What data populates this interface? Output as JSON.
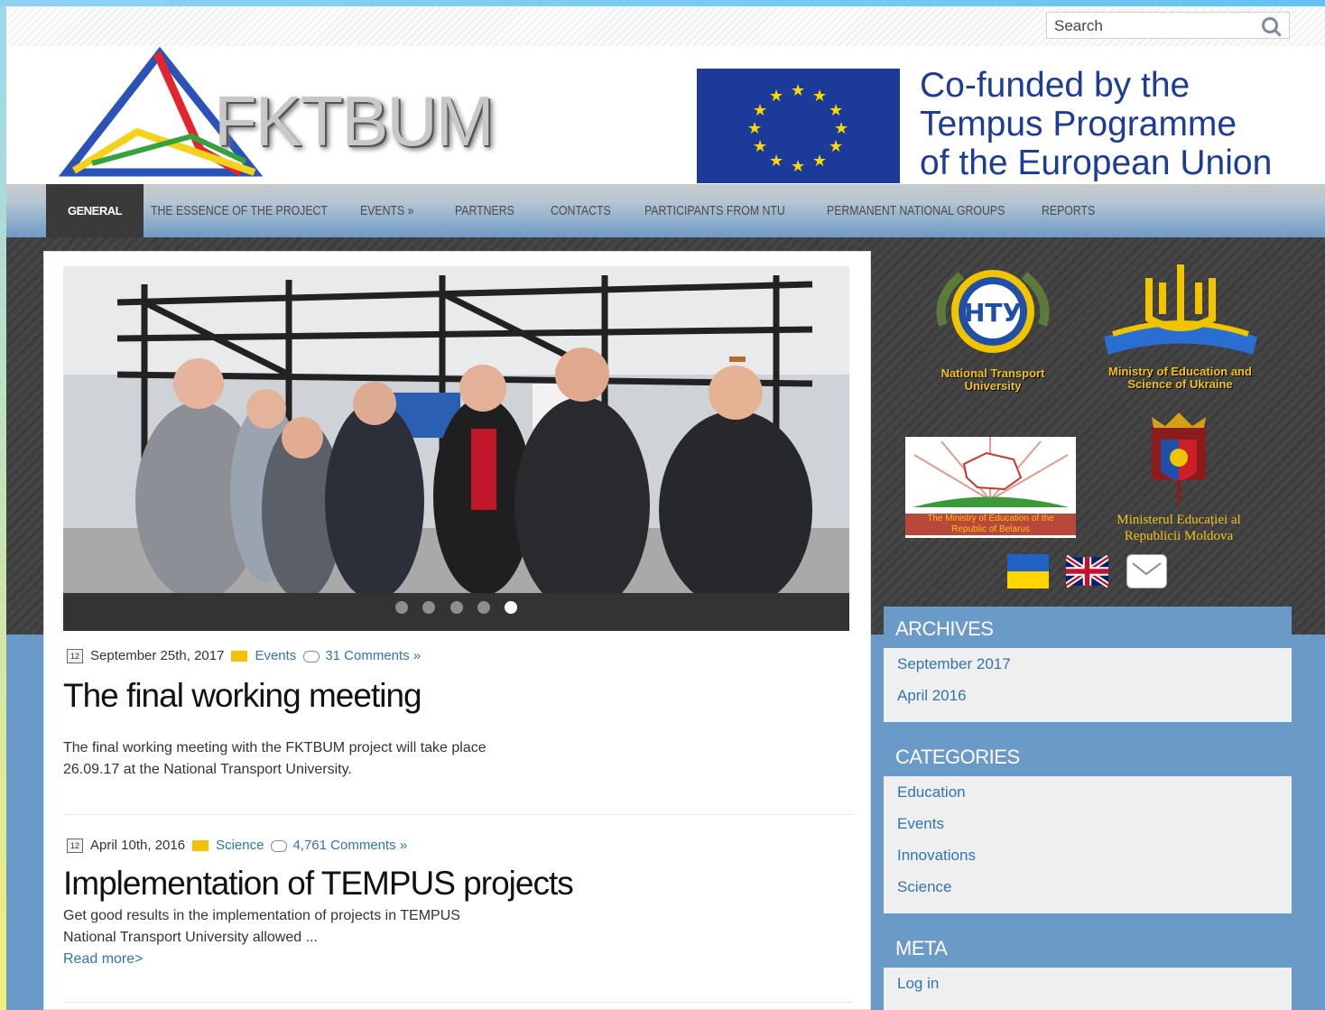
{
  "search": {
    "placeholder": "Search"
  },
  "header": {
    "logo_text": "FKTBUM",
    "eu_lines": [
      "Co-funded by the",
      "Tempus Programme",
      "of the European Union"
    ]
  },
  "nav": {
    "items": [
      "GENERAL",
      "THE ESSENCE OF THE PROJECT",
      "EVENTS »",
      "PARTNERS",
      "CONTACTS",
      "PARTICIPANTS FROM NTU",
      "PERMANENT NATIONAL GROUPS",
      "REPORTS"
    ],
    "active": "GENERAL"
  },
  "slider": {
    "dots": 5,
    "active_dot": 5
  },
  "posts": [
    {
      "date": "September 25th, 2017",
      "category": "Events",
      "comments": "31 Comments »",
      "title": "The final working meeting",
      "body_1": "The final working meeting with the FKTBUM project will take place",
      "body_2": "26.09.17 at the National Transport University."
    },
    {
      "date": "April 10th, 2016",
      "category": "Science",
      "comments": "4,761 Comments »",
      "title": "Implementation of TEMPUS projects",
      "body_1": "Get good results in the implementation of projects in TEMPUS",
      "body_2": "National Transport University allowed ...",
      "read_more": "Read more>"
    }
  ],
  "partners": {
    "ntu_1": "National Transport",
    "ntu_2": "University",
    "ntu_emblem": "НТУ",
    "mon_1": "Ministry of Education and",
    "mon_2": "Science of Ukraine",
    "belarus_1": "The Ministry of Education of the",
    "belarus_2": "Republic of Belarus",
    "moldova_1": "Ministerul Educației al",
    "moldova_2": "Republicii Moldova"
  },
  "sidebar": {
    "archives_title": "ARCHIVES",
    "archives": [
      "September 2017",
      "April 2016"
    ],
    "categories_title": "CATEGORIES",
    "categories": [
      "Education",
      "Events",
      "Innovations",
      "Science"
    ],
    "meta_title": "META",
    "meta": [
      "Log in"
    ]
  },
  "colors": {
    "accent_blue": "#6a9bc8",
    "link": "#2f74b5",
    "eu_blue": "#1c3a99",
    "nav_active": "#3a3a3a"
  }
}
